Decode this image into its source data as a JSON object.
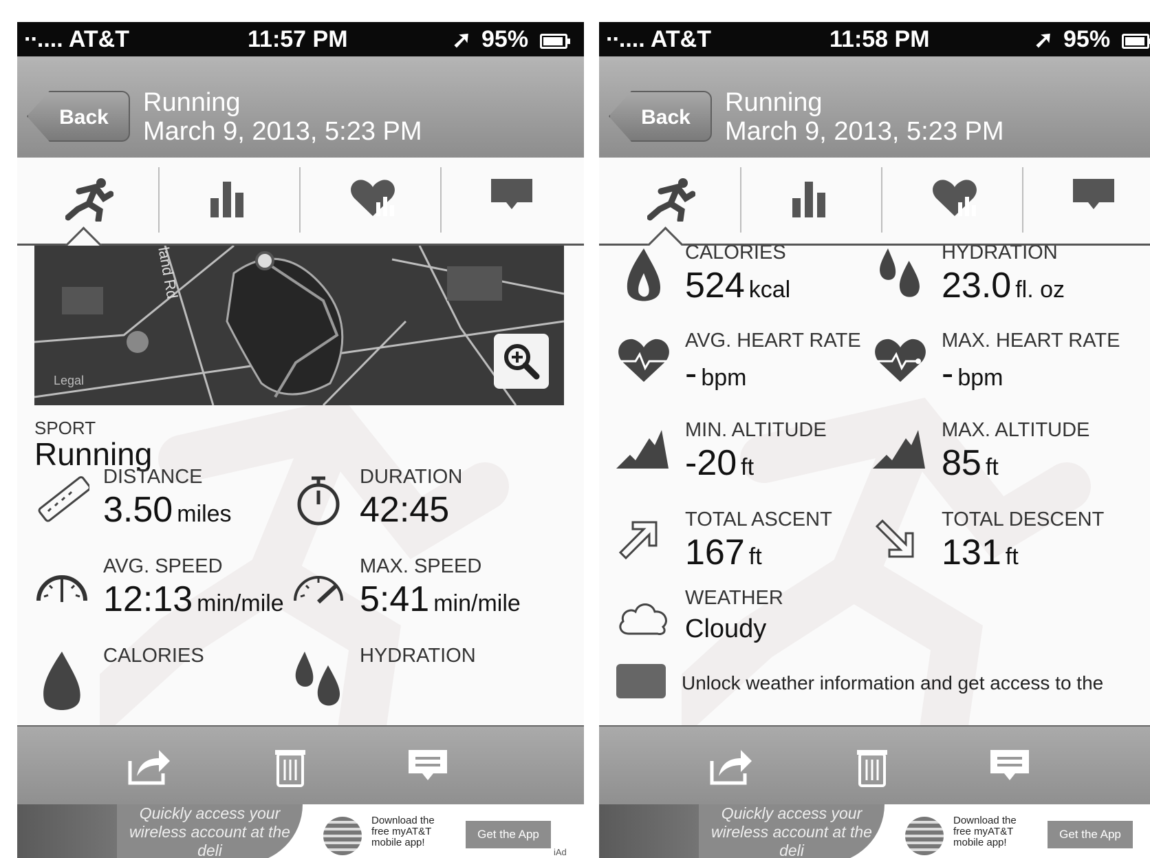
{
  "left": {
    "status": {
      "carrier": "∙∙.... AT&T",
      "time": "11:57 PM",
      "battery": "95%"
    },
    "nav": {
      "back": "Back",
      "title": "Running",
      "subtitle": "March 9, 2013, 5:23 PM"
    },
    "map": {
      "road_label": "land Rd",
      "legal": "Legal"
    },
    "sport": {
      "label": "SPORT",
      "value": "Running"
    },
    "stats": [
      {
        "label": "DISTANCE",
        "value": "3.50",
        "unit": "miles",
        "icon": "ruler-icon"
      },
      {
        "label": "DURATION",
        "value": "42:45",
        "unit": "",
        "icon": "stopwatch-icon"
      },
      {
        "label": "AVG. SPEED",
        "value": "12:13",
        "unit": "min/mile",
        "icon": "speedometer-icon"
      },
      {
        "label": "MAX. SPEED",
        "value": "5:41",
        "unit": "min/mile",
        "icon": "speedometer-max-icon"
      },
      {
        "label": "CALORIES",
        "value": "",
        "unit": "",
        "icon": "flame-icon"
      },
      {
        "label": "HYDRATION",
        "value": "",
        "unit": "",
        "icon": "drops-icon"
      }
    ],
    "ad": {
      "bubble": "Quickly access your wireless account at the deli",
      "download": "Download the free myAT&T mobile app!",
      "button": "Get the App",
      "tag": "iAd"
    }
  },
  "right": {
    "status": {
      "carrier": "∙∙.... AT&T",
      "time": "11:58 PM",
      "battery": "95%"
    },
    "nav": {
      "back": "Back",
      "title": "Running",
      "subtitle": "March 9, 2013, 5:23 PM"
    },
    "stats": [
      {
        "label": "CALORIES",
        "value": "524",
        "unit": "kcal",
        "icon": "flame-icon"
      },
      {
        "label": "HYDRATION",
        "value": "23.0",
        "unit": "fl. oz",
        "icon": "drops-icon"
      },
      {
        "label": "AVG. HEART RATE",
        "value": "-",
        "unit": "bpm",
        "icon": "heart-rate-icon"
      },
      {
        "label": "MAX. HEART RATE",
        "value": "-",
        "unit": "bpm",
        "icon": "heart-rate-max-icon"
      },
      {
        "label": "MIN. ALTITUDE",
        "value": "-20",
        "unit": "ft",
        "icon": "mountain-icon"
      },
      {
        "label": "MAX. ALTITUDE",
        "value": "85",
        "unit": "ft",
        "icon": "mountain-max-icon"
      },
      {
        "label": "TOTAL ASCENT",
        "value": "167",
        "unit": "ft",
        "icon": "arrow-up-right-icon"
      },
      {
        "label": "TOTAL DESCENT",
        "value": "131",
        "unit": "ft",
        "icon": "arrow-down-right-icon"
      },
      {
        "label": "WEATHER",
        "value": "Cloudy",
        "unit": "",
        "icon": "cloud-icon"
      }
    ],
    "unlock": "Unlock weather information and get access to the",
    "ad": {
      "bubble": "Quickly access your wireless account at the deli",
      "download": "Download the free myAT&T mobile app!",
      "button": "Get the App"
    }
  },
  "colors": {
    "status_bar": "#0a0a0a",
    "nav_bar": "#9e9e9e",
    "toolbar": "#9a9a9a",
    "icon": "#444444"
  }
}
